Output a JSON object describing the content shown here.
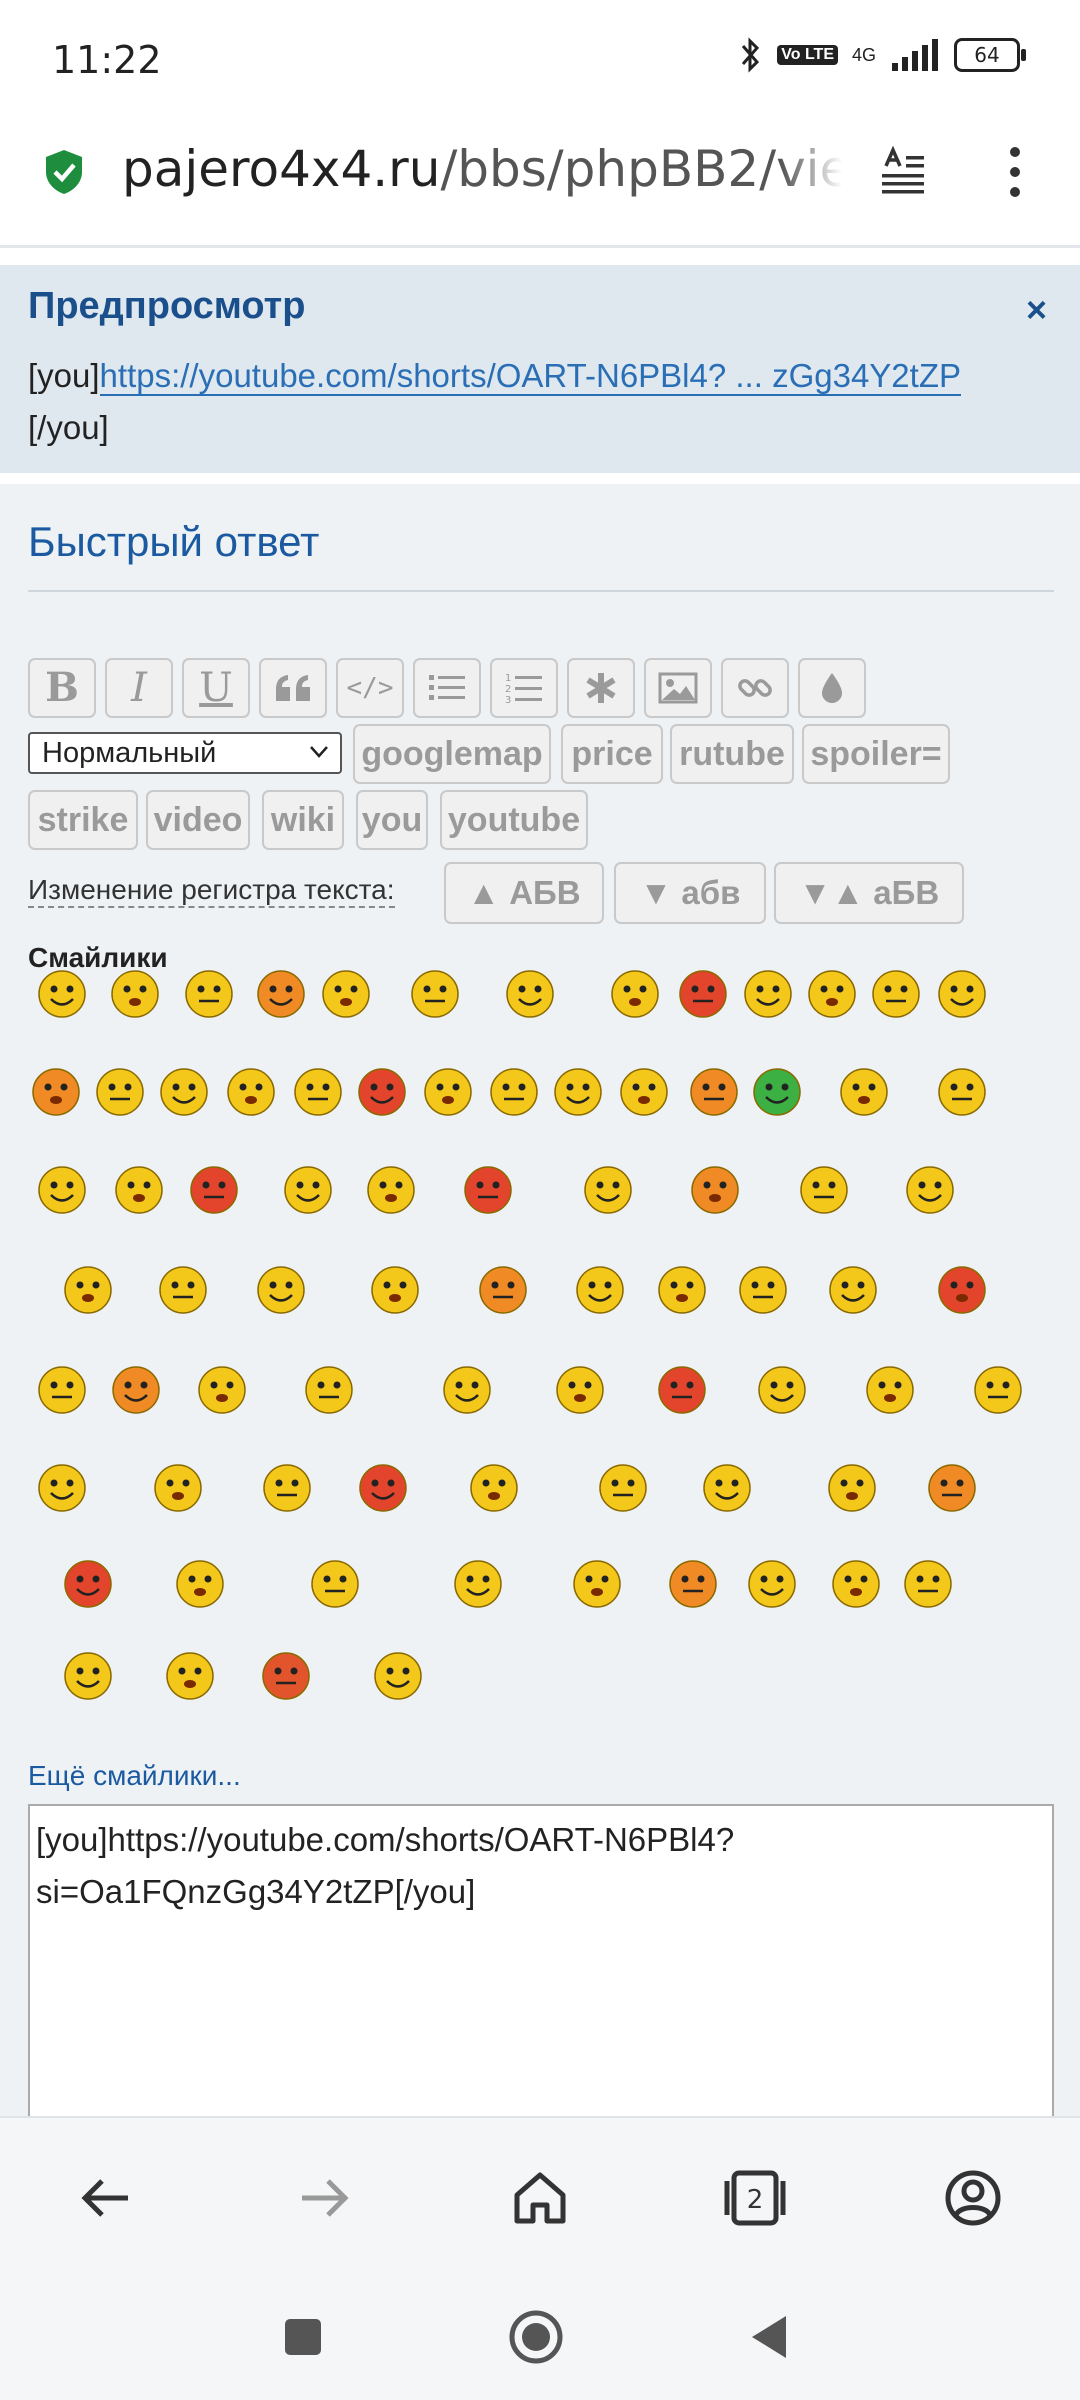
{
  "status": {
    "time": "11:22",
    "volte": "Vo LTE",
    "network": "4G",
    "battery": "64"
  },
  "browser": {
    "url_domain": "pajero4x4.ru",
    "url_rest": "/bbs/phpBB2/viewtopic"
  },
  "preview": {
    "title": "Предпросмотр",
    "close": "×",
    "prefix": "[you]",
    "link_text": "https://youtube.com/shorts/OART-N6PBl4? ... zGg34Y2tZP",
    "suffix": "[/you]"
  },
  "quick_reply": {
    "heading": "Быстрый ответ",
    "toolbar_icons": [
      "bold-icon",
      "italic-icon",
      "underline-icon",
      "quote-icon",
      "code-icon",
      "bulleted-list-icon",
      "numbered-list-icon",
      "asterisk-icon",
      "image-icon",
      "link-icon",
      "color-drop-icon"
    ],
    "bold": "B",
    "italic": "I",
    "underline": "U",
    "quote": "“",
    "code": "</>",
    "size_select": "Нормальный",
    "tags": [
      "googlemap",
      "price",
      "rutube",
      "spoiler=",
      "strike",
      "video",
      "wiki",
      "you",
      "youtube"
    ],
    "case_label": "Изменение регистра текста:",
    "case_buttons": [
      "▲ АБВ",
      "▼ абв",
      "▼▲ аБВ"
    ],
    "smiles_title": "Смайлики",
    "more_smiles": "Ещё смайлики...",
    "message_text": "[you]https://youtube.com/shorts/OART-N6PBl4?si=Oa1FQnzGg34Y2tZP[/you]"
  },
  "colors": {
    "accent": "#1b5aa0",
    "link": "#2a6eb5",
    "preview_bg": "#dfe8ef",
    "panel_bg": "#eef2f5",
    "smile_yellow": "#f3c81a"
  }
}
